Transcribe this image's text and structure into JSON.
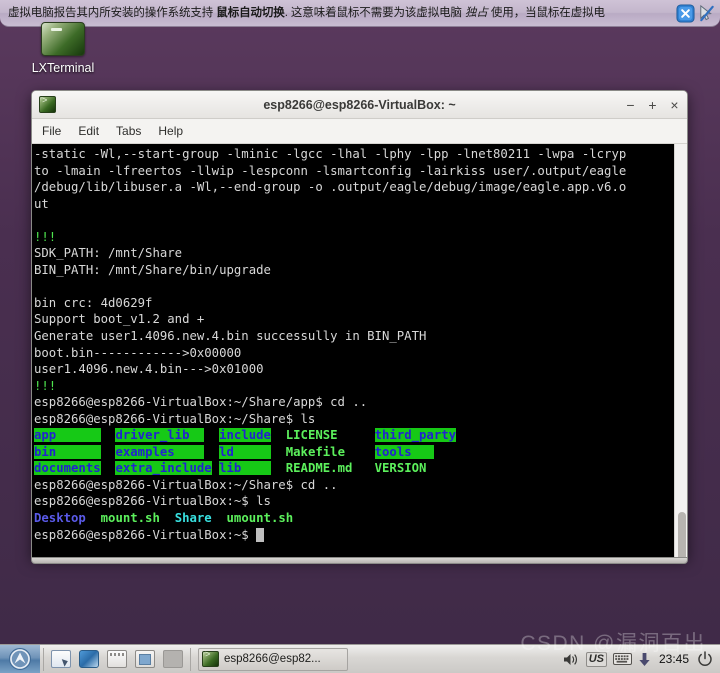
{
  "vbox_bar": {
    "message_part1": "虚拟电脑报告其内所安装的操作系统支持 ",
    "message_bold": "鼠标自动切换",
    "message_part2": ". 这意味着鼠标不需要为该虚拟电脑 ",
    "message_italic": "独占",
    "message_part3": " 使用，当鼠标在虚拟电",
    "close_icon": "close-circle-icon",
    "pointer_icon": "mouse-pointer-disabled-icon"
  },
  "desktop": {
    "icon_label": "LXTerminal",
    "icon_name": "terminal-icon"
  },
  "terminal": {
    "title": "esp8266@esp8266-VirtualBox: ~",
    "window_icon": "terminal-icon",
    "buttons": {
      "minimize": "−",
      "maximize": "+",
      "close": "×"
    },
    "menu": [
      "File",
      "Edit",
      "Tabs",
      "Help"
    ],
    "lines": [
      [
        {
          "t": "-static -Wl,--start-group -lminic -lgcc -lhal -lphy -lpp -lnet80211 -lwpa -lcryp",
          "c": "c-white"
        }
      ],
      [
        {
          "t": "to -lmain -lfreertos -llwip -lespconn -lsmartconfig -lairkiss user/.output/eagle",
          "c": "c-white"
        }
      ],
      [
        {
          "t": "/debug/lib/libuser.a -Wl,--end-group -o .output/eagle/debug/image/eagle.app.v6.o",
          "c": "c-white"
        }
      ],
      [
        {
          "t": "ut",
          "c": "c-white"
        }
      ],
      [
        {
          "t": "",
          "c": "c-white"
        }
      ],
      [
        {
          "t": "!!!",
          "c": "c-green"
        }
      ],
      [
        {
          "t": "SDK_PATH: /mnt/Share",
          "c": "c-white"
        }
      ],
      [
        {
          "t": "BIN_PATH: /mnt/Share/bin/upgrade",
          "c": "c-white"
        }
      ],
      [
        {
          "t": "",
          "c": "c-white"
        }
      ],
      [
        {
          "t": "bin crc: 4d0629f",
          "c": "c-white"
        }
      ],
      [
        {
          "t": "Support boot_v1.2 and +",
          "c": "c-white"
        }
      ],
      [
        {
          "t": "Generate user1.4096.new.4.bin successully in BIN_PATH",
          "c": "c-white"
        }
      ],
      [
        {
          "t": "boot.bin------------>0x00000",
          "c": "c-white"
        }
      ],
      [
        {
          "t": "user1.4096.new.4.bin--->0x01000",
          "c": "c-white"
        }
      ],
      [
        {
          "t": "!!!",
          "c": "c-green"
        }
      ],
      [
        {
          "t": "esp8266@esp8266-VirtualBox:~/Share/app$ cd ..",
          "c": "c-white"
        }
      ],
      [
        {
          "t": "esp8266@esp8266-VirtualBox:~/Share$ ls",
          "c": "c-white"
        }
      ],
      [
        {
          "t": "app      ",
          "c": "c-dirhl"
        },
        {
          "t": "  ",
          "c": "c-white"
        },
        {
          "t": "driver_lib  ",
          "c": "c-dirhl"
        },
        {
          "t": "  ",
          "c": "c-white"
        },
        {
          "t": "include",
          "c": "c-dirhl"
        },
        {
          "t": "  ",
          "c": "c-white"
        },
        {
          "t": "LICENSE   ",
          "c": "c-file"
        },
        {
          "t": "  ",
          "c": "c-white"
        },
        {
          "t": "third_party",
          "c": "c-dirhl"
        }
      ],
      [
        {
          "t": "bin      ",
          "c": "c-dirhl"
        },
        {
          "t": "  ",
          "c": "c-white"
        },
        {
          "t": "examples    ",
          "c": "c-dirhl"
        },
        {
          "t": "  ",
          "c": "c-white"
        },
        {
          "t": "ld     ",
          "c": "c-dirhl"
        },
        {
          "t": "  ",
          "c": "c-white"
        },
        {
          "t": "Makefile  ",
          "c": "c-file"
        },
        {
          "t": "  ",
          "c": "c-white"
        },
        {
          "t": "tools   ",
          "c": "c-dirhl"
        }
      ],
      [
        {
          "t": "documents",
          "c": "c-dirhl"
        },
        {
          "t": "  ",
          "c": "c-white"
        },
        {
          "t": "extra_include",
          "c": "c-dirhl"
        },
        {
          "t": " ",
          "c": "c-white"
        },
        {
          "t": "lib    ",
          "c": "c-dirhl"
        },
        {
          "t": "  ",
          "c": "c-white"
        },
        {
          "t": "README.md ",
          "c": "c-file"
        },
        {
          "t": "  ",
          "c": "c-white"
        },
        {
          "t": "VERSION",
          "c": "c-file"
        }
      ],
      [
        {
          "t": "esp8266@esp8266-VirtualBox:~/Share$ cd ..",
          "c": "c-white"
        }
      ],
      [
        {
          "t": "esp8266@esp8266-VirtualBox:~$ ls",
          "c": "c-white"
        }
      ],
      [
        {
          "t": "Desktop",
          "c": "c-blue"
        },
        {
          "t": "  ",
          "c": "c-white"
        },
        {
          "t": "mount.sh",
          "c": "c-file"
        },
        {
          "t": "  ",
          "c": "c-white"
        },
        {
          "t": "Share",
          "c": "c-cyan"
        },
        {
          "t": "  ",
          "c": "c-white"
        },
        {
          "t": "umount.sh",
          "c": "c-file"
        }
      ],
      [
        {
          "t": "esp8266@esp8266-VirtualBox:~$ ",
          "c": "c-white"
        },
        {
          "t": " ",
          "c": "cursor"
        }
      ]
    ]
  },
  "taskbar": {
    "start_icon": "start-menu-icon",
    "launchers": [
      {
        "name": "file-manager-icon"
      },
      {
        "name": "web-browser-icon"
      },
      {
        "name": "terminal-launcher-icon"
      },
      {
        "name": "minimize-all-icon"
      },
      {
        "name": "desktop-pager-icon"
      }
    ],
    "task_label": "esp8266@esp82...",
    "task_icon": "terminal-icon",
    "tray": {
      "volume_icon": "speaker-icon",
      "language": "US",
      "keyboard_icon": "keyboard-icon",
      "updates_icon": "download-arrow-icon",
      "clock": "23:45",
      "power_icon": "power-icon"
    }
  },
  "watermark": "CSDN @漏洞百出"
}
